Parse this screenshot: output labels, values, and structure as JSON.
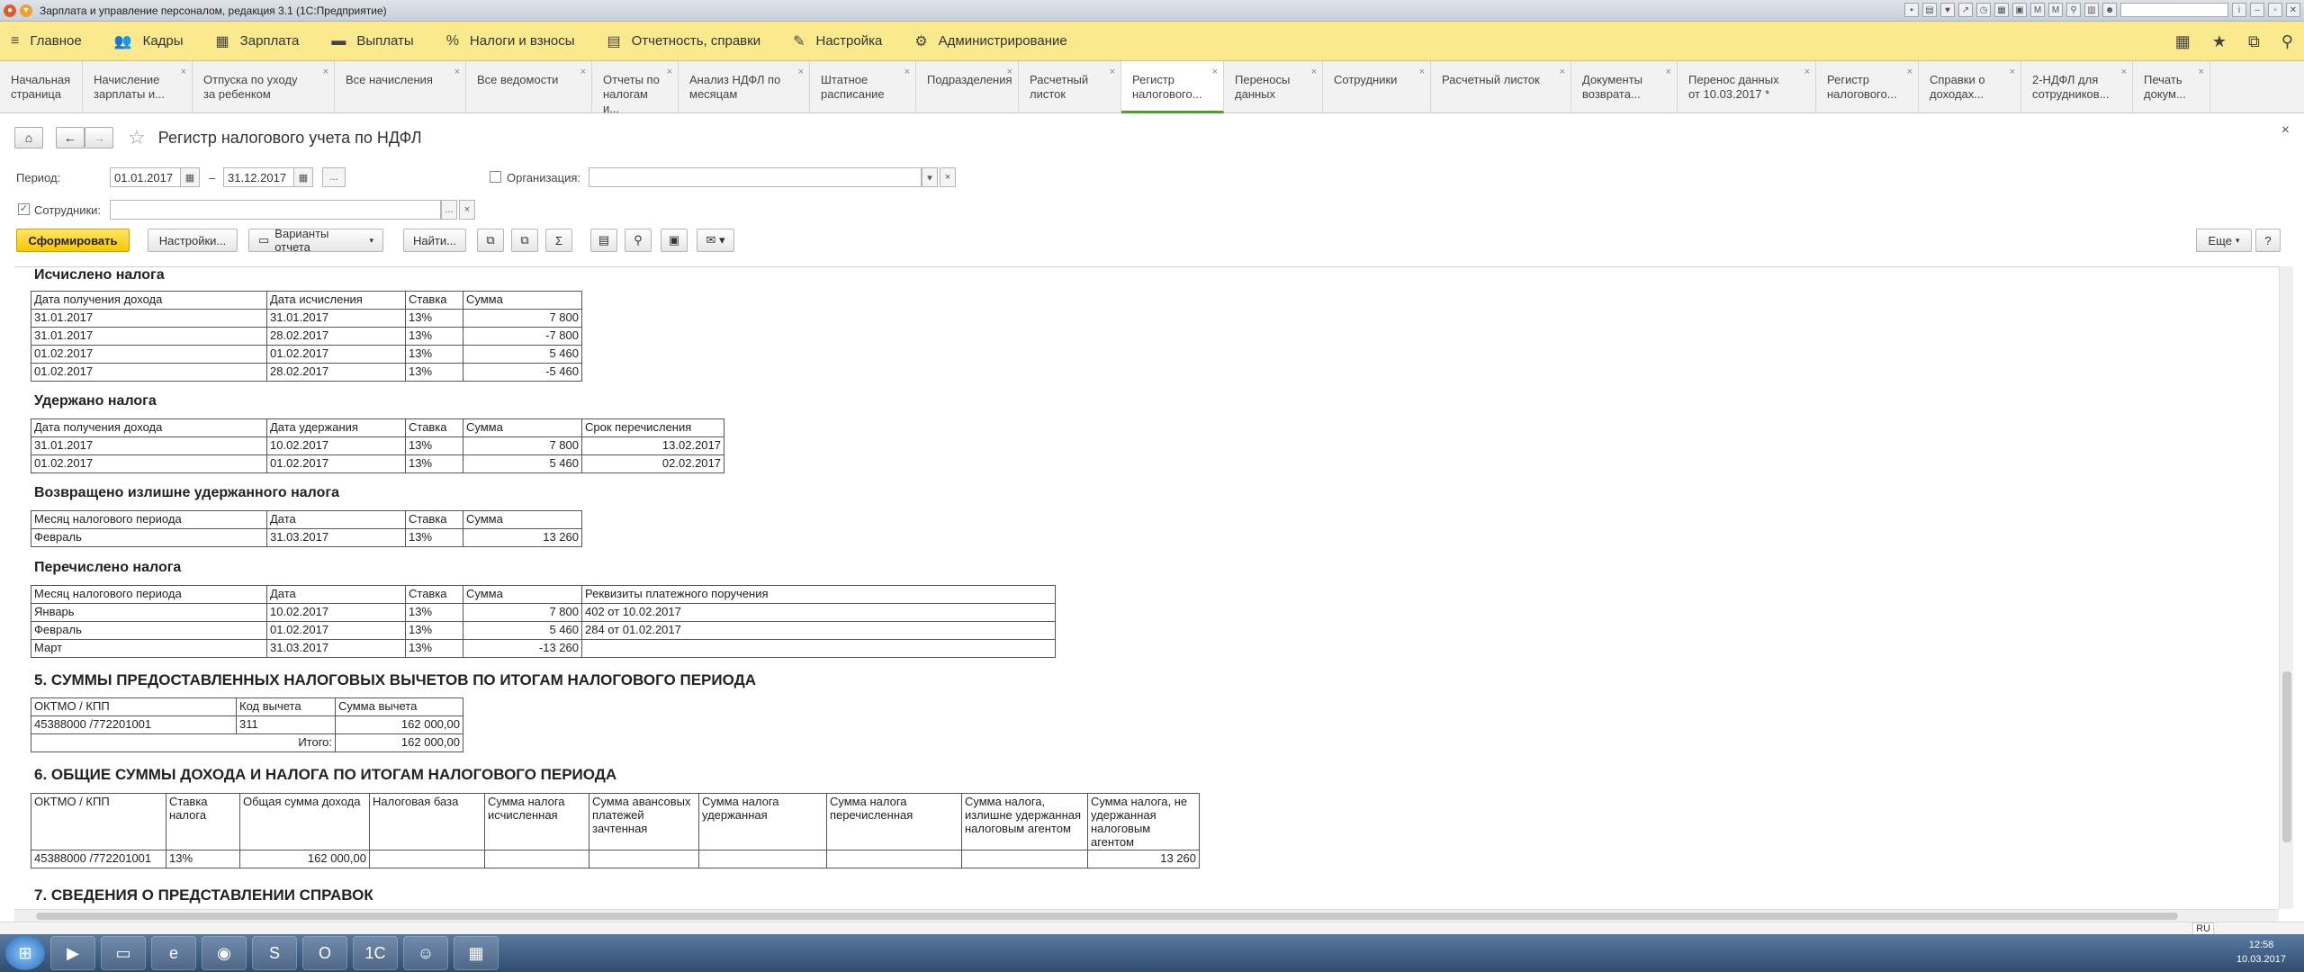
{
  "window": {
    "title": "Зарплата и управление персоналом, редакция 3.1  (1С:Предприятие)"
  },
  "sections": [
    {
      "icon": "menu-icon",
      "label": "Главное"
    },
    {
      "icon": "people-icon",
      "label": "Кадры"
    },
    {
      "icon": "calculator-icon",
      "label": "Зарплата"
    },
    {
      "icon": "wallet-icon",
      "label": "Выплаты"
    },
    {
      "icon": "percent-icon",
      "label": "Налоги и взносы"
    },
    {
      "icon": "document-icon",
      "label": "Отчетность, справки"
    },
    {
      "icon": "wrench-icon",
      "label": "Настройка"
    },
    {
      "icon": "gear-icon",
      "label": "Администрирование"
    }
  ],
  "tabs": [
    {
      "label": "Начальная\nстраница"
    },
    {
      "label": "Начисление\nзарплаты и..."
    },
    {
      "label": "Отпуска по уходу\nза ребенком"
    },
    {
      "label": "Все начисления"
    },
    {
      "label": "Все ведомости"
    },
    {
      "label": "Отчеты по\nналогам и..."
    },
    {
      "label": "Анализ НДФЛ по\nмесяцам"
    },
    {
      "label": "Штатное\nрасписание"
    },
    {
      "label": "Подразделения"
    },
    {
      "label": "Расчетный\nлисток"
    },
    {
      "label": "Регистр\nналогового..."
    },
    {
      "label": "Переносы\nданных"
    },
    {
      "label": "Сотрудники"
    },
    {
      "label": "Расчетный листок"
    },
    {
      "label": "Документы\nвозврата..."
    },
    {
      "label": "Перенос данных\nот 10.03.2017 *"
    },
    {
      "label": "Регистр\nналогового..."
    },
    {
      "label": "Справки о\nдоходах..."
    },
    {
      "label": "2-НДФЛ для\nсотрудников..."
    },
    {
      "label": "Печать\nдокум..."
    }
  ],
  "form": {
    "title": "Регистр налогового учета по НДФЛ",
    "period_label": "Период:",
    "period_from": "01.01.2017",
    "period_dash": "–",
    "period_to": "31.12.2017",
    "period_more": "...",
    "org_label": "Организация:",
    "org_value": "",
    "employees_label": "Сотрудники:",
    "employees_value": "",
    "employees_more": "..."
  },
  "toolbar": {
    "generate": "Сформировать",
    "settings": "Настройки...",
    "variants": "Варианты отчета",
    "find": "Найти...",
    "more": "Еще",
    "help": "?"
  },
  "report": {
    "calc": {
      "heading": "Исчислено налога",
      "headers": [
        "Дата получения дохода",
        "Дата исчисления",
        "Ставка",
        "Сумма"
      ],
      "rows": [
        [
          "31.01.2017",
          "31.01.2017",
          "13%",
          "7 800"
        ],
        [
          "31.01.2017",
          "28.02.2017",
          "13%",
          "-7 800"
        ],
        [
          "01.02.2017",
          "01.02.2017",
          "13%",
          "5 460"
        ],
        [
          "01.02.2017",
          "28.02.2017",
          "13%",
          "-5 460"
        ]
      ]
    },
    "withheld": {
      "heading": "Удержано налога",
      "headers": [
        "Дата получения дохода",
        "Дата удержания",
        "Ставка",
        "Сумма",
        "Срок перечисления"
      ],
      "rows": [
        [
          "31.01.2017",
          "10.02.2017",
          "13%",
          "7 800",
          "13.02.2017"
        ],
        [
          "01.02.2017",
          "01.02.2017",
          "13%",
          "5 460",
          "02.02.2017"
        ]
      ]
    },
    "returned": {
      "heading": "Возвращено излишне удержанного налога",
      "headers": [
        "Месяц налогового периода",
        "Дата",
        "Ставка",
        "Сумма"
      ],
      "rows": [
        [
          "Февраль",
          "31.03.2017",
          "13%",
          "13 260"
        ]
      ]
    },
    "paid": {
      "heading": "Перечислено налога",
      "headers": [
        "Месяц налогового периода",
        "Дата",
        "Ставка",
        "Сумма",
        "Реквизиты платежного поручения"
      ],
      "rows": [
        [
          "Январь",
          "10.02.2017",
          "13%",
          "7 800",
          "402 от 10.02.2017"
        ],
        [
          "Февраль",
          "01.02.2017",
          "13%",
          "5 460",
          "284 от 01.02.2017"
        ],
        [
          "Март",
          "31.03.2017",
          "13%",
          "-13 260",
          ""
        ]
      ]
    },
    "sec5": {
      "heading": "5. СУММЫ ПРЕДОСТАВЛЕННЫХ НАЛОГОВЫХ ВЫЧЕТОВ ПО ИТОГАМ НАЛОГОВОГО ПЕРИОДА",
      "headers": [
        "ОКТМО / КПП",
        "Код вычета",
        "Сумма вычета"
      ],
      "rows": [
        [
          "45388000   /772201001",
          "311",
          "162 000,00"
        ]
      ],
      "total_label": "Итого:",
      "total_value": "162 000,00"
    },
    "sec6": {
      "heading": "6. ОБЩИЕ СУММЫ ДОХОДА И НАЛОГА ПО ИТОГАМ НАЛОГОВОГО ПЕРИОДА",
      "headers": [
        "ОКТМО / КПП",
        "Ставка налога",
        "Общая сумма дохода",
        "Налоговая база",
        "Сумма налога исчисленная",
        "Сумма авансовых платежей зачтенная",
        "Сумма налога удержанная",
        "Сумма налога перечисленная",
        "Сумма налога, излишне удержанная налоговым агентом",
        "Сумма налога, не удержанная налоговым агентом"
      ],
      "row": [
        "45388000   /772201001",
        "13%",
        "162 000,00",
        "",
        "",
        "",
        "",
        "",
        "",
        "13 260"
      ]
    },
    "sec7": {
      "heading": "7. СВЕДЕНИЯ О ПРЕДСТАВЛЕНИИ СПРАВОК"
    }
  },
  "status": {
    "lang": "RU"
  },
  "clock": {
    "time": "12:58",
    "date": "10.03.2017"
  }
}
